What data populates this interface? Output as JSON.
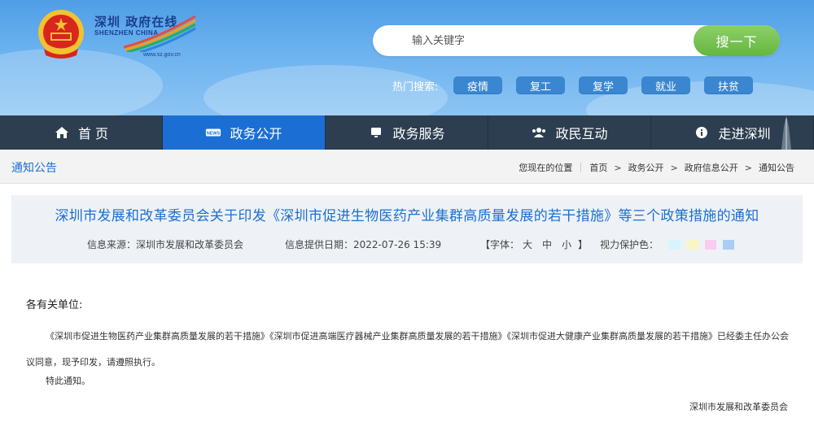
{
  "header": {
    "logo_cn": "深圳 政府在线",
    "logo_en": "SHENZHEN CHINA",
    "logo_url": "www.sz.gov.cn",
    "search_placeholder": "输入关键字",
    "search_button": "搜一下",
    "hot_label": "热门搜索:",
    "hot_tags": [
      "疫情",
      "复工",
      "复学",
      "就业",
      "扶贫"
    ]
  },
  "nav": {
    "items": [
      {
        "label": "首 页",
        "icon": "home-icon"
      },
      {
        "label": "政务公开",
        "icon": "news-icon"
      },
      {
        "label": "政务服务",
        "icon": "monitor-icon"
      },
      {
        "label": "政民互动",
        "icon": "people-icon"
      },
      {
        "label": "走进深圳",
        "icon": "info-icon"
      }
    ],
    "active_index": 1
  },
  "breadcrumb": {
    "section_title": "通知公告",
    "location_label": "您现在的位置",
    "items": [
      "首页",
      "政务公开",
      "政府信息公开",
      "通知公告"
    ]
  },
  "article": {
    "title": "深圳市发展和改革委员会关于印发《深圳市促进生物医药产业集群高质量发展的若干措施》等三个政策措施的通知",
    "source": "信息来源：深圳市发展和改革委员会",
    "date": "信息提供日期：2022-07-26 15:39",
    "font_bracket_open": "【字体：",
    "font_sizes": [
      "大",
      "中",
      "小"
    ],
    "font_bracket_close": "】",
    "eye_care_label": "视力保护色：",
    "eye_care_colors": [
      "#d6f4fb",
      "#f8f7c4",
      "#f9cdf0",
      "#a9cdf4"
    ],
    "salutation": "各有关单位:",
    "paragraph": "《深圳市促进生物医药产业集群高质量发展的若干措施》《深圳市促进高端医疗器械产业集群高质量发展的若干措施》《深圳市促进大健康产业集群高质量发展的若干措施》已经委主任办公会议同意，现予印发，请遵照执行。",
    "closing": "特此通知。",
    "signoff": "深圳市发展和改革委员会"
  },
  "colors": {
    "accent": "#1b6fd4",
    "nav_bg": "#2c3e50",
    "search_button": "#6cbb45",
    "hot_tag": "#3a86d0"
  }
}
